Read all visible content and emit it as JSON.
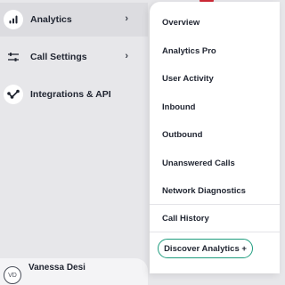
{
  "sidebar": {
    "items": [
      {
        "label": "Analytics",
        "icon": "bar-chart-icon",
        "has_submenu": true,
        "active": true
      },
      {
        "label": "Call Settings",
        "icon": "sliders-icon",
        "has_submenu": true,
        "active": false
      },
      {
        "label": "Integrations & API",
        "icon": "integrations-icon",
        "has_submenu": false,
        "active": false
      }
    ],
    "chevron": "›"
  },
  "user": {
    "name": "Vanessa Desi",
    "initials": "VD"
  },
  "header": {
    "language_flag": "uk-flag-icon"
  },
  "submenu": {
    "items": [
      {
        "label": "Overview"
      },
      {
        "label": "Analytics Pro"
      },
      {
        "label": "User Activity"
      },
      {
        "label": "Inbound"
      },
      {
        "label": "Outbound"
      },
      {
        "label": "Unanswered Calls"
      },
      {
        "label": "Network Diagnostics"
      },
      {
        "label": "Call History"
      }
    ],
    "discover_label": "Discover Analytics +"
  },
  "colors": {
    "background": "#e7e7ea",
    "active_item": "#dcdce0",
    "accent": "#1e9c7e",
    "text": "#1f2430"
  }
}
